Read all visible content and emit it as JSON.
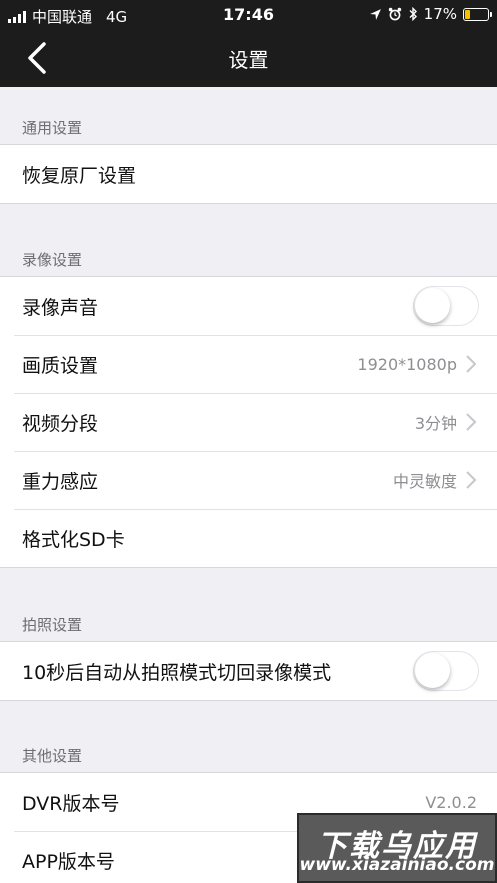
{
  "status_bar": {
    "carrier": "中国联通",
    "network": "4G",
    "time": "17:46",
    "battery": "17%",
    "battery_color": "#f5c000"
  },
  "navbar": {
    "title": "设置",
    "back_icon": "chevron-left-icon"
  },
  "sections": {
    "general": {
      "header": "通用设置",
      "rows": [
        {
          "label": "恢复原厂设置"
        }
      ]
    },
    "recording": {
      "header": "录像设置",
      "rows": [
        {
          "label": "录像声音",
          "toggle": false
        },
        {
          "label": "画质设置",
          "value": "1920*1080p"
        },
        {
          "label": "视频分段",
          "value": "3分钟"
        },
        {
          "label": "重力感应",
          "value": "中灵敏度"
        },
        {
          "label": "格式化SD卡"
        }
      ]
    },
    "photo": {
      "header": "拍照设置",
      "rows": [
        {
          "label": "10秒后自动从拍照模式切回录像模式",
          "toggle": false
        }
      ]
    },
    "other": {
      "header": "其他设置",
      "rows": [
        {
          "label": "DVR版本号",
          "value": "V2.0.2"
        },
        {
          "label": "APP版本号"
        }
      ]
    }
  },
  "watermark": {
    "line1": "下载乌应用",
    "line2": "www.xiazainiao.com"
  }
}
